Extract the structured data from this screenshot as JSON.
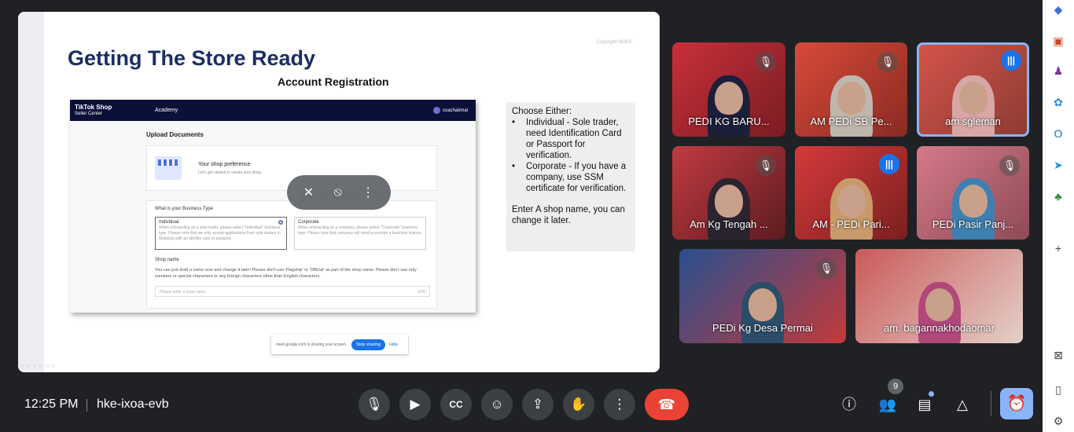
{
  "slide": {
    "copyright": "Copyright MDEC",
    "title": "Getting The Store Ready",
    "subtitle": "Account Registration",
    "shot": {
      "brand": "TikTok Shop",
      "brand_sub": "Seller Center",
      "academy": "Academy",
      "user": "coachakmal",
      "heading": "Upload Documents",
      "pref_title": "Your shop preference",
      "pref_sub": "Let's get started to create your shop.",
      "btype_heading": "What is your Business Type",
      "opt1_title": "Individual",
      "opt1_text": "When onboarding as a sole trader, please select \"Individual\" business type. Please note that we only accept applications from sole traders in Malaysia with an identity card or passport.",
      "opt2_title": "Corporate",
      "opt2_text": "When onboarding as a company, please select \"Corporate\" business type. Please note that company will need to provide a business license.",
      "shopname_heading": "Shop name",
      "shopname_text": "You can just draft a name now and change it later! Please don't use 'Flagship' or 'Official' as part of the shop name. Please don't use only numbers or special characters or any foreign characters other than English characters.",
      "shopname_placeholder": "Please enter a shop name",
      "shopname_count": "0/30"
    },
    "info": {
      "intro": "Choose Either:",
      "items": [
        "Individual - Sole trader, need Identification Card or Passport for verification.",
        "Corporate - If you have a company, use SSM certificate for verification."
      ],
      "footer": "Enter A shop name, you can change it later."
    },
    "share_bar": {
      "text": "meet.google.com is sharing your screen.",
      "stop": "Stop sharing",
      "hide": "Hide"
    }
  },
  "participants": [
    {
      "name": "PEDI KG BARU...",
      "status": "muted"
    },
    {
      "name": "AM PEDi SB Pe...",
      "status": "muted"
    },
    {
      "name": "am sgleman",
      "status": "speaking"
    },
    {
      "name": "Am Kg Tengah ...",
      "status": "muted"
    },
    {
      "name": "AM - PEDi Pari...",
      "status": "speaking"
    },
    {
      "name": "PEDi Pasir Panj...",
      "status": "muted"
    },
    {
      "name": "PEDi Kg Desa Permai",
      "status": "muted"
    },
    {
      "name": "am. bagannakhodaomar",
      "status": "none"
    }
  ],
  "footer": {
    "time": "12:25 PM",
    "meeting_code": "hke-ixoa-evb",
    "people_count": "9"
  },
  "colors": {
    "background": "#202124",
    "accent": "#8ab4f8",
    "end_call": "#ea4335",
    "slide_title": "#1b2d63"
  }
}
